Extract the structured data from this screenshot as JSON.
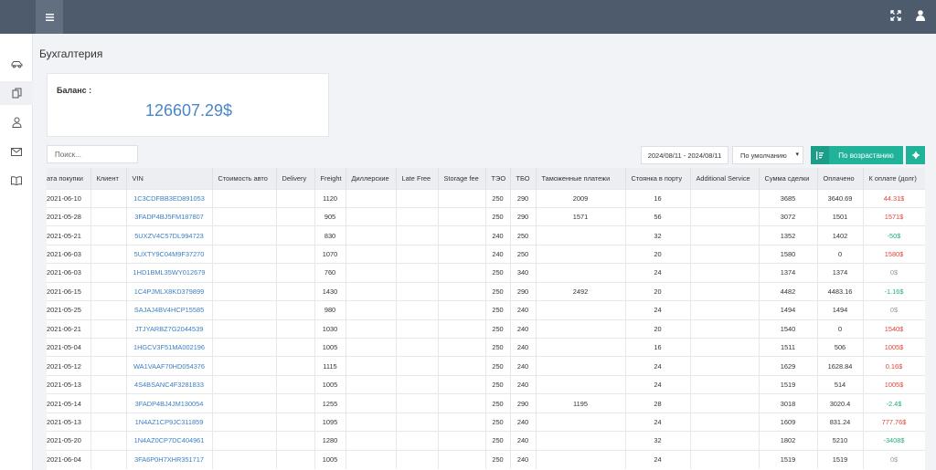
{
  "page_title": "Бухгалтерия",
  "balance": {
    "label": "Баланс :",
    "value": "126607.29$"
  },
  "search": {
    "placeholder": "Поиск..."
  },
  "filters": {
    "date_range": "2024/08/11 - 2024/08/11",
    "sort_select": "По умолчанию",
    "sort_button": "По возрастанию"
  },
  "colors": {
    "topbar": "#4e5b6d",
    "accent": "#21b39a",
    "link": "#3c7ec4",
    "debt": "#e0443c",
    "overpaid": "#28a982"
  },
  "icons": {
    "topbar": [
      "hamburger-icon",
      "fullscreen-icon",
      "user-icon"
    ],
    "sidebar": [
      "car-icon",
      "documents-icon",
      "person-icon",
      "mail-icon",
      "book-icon"
    ],
    "buttons": [
      "sort-ascending-icon",
      "gear-icon"
    ]
  },
  "table": {
    "headers": [
      "ата покупки",
      "Клиент",
      "VIN",
      "Стоимость авто",
      "Delivery",
      "Freight",
      "Диллерские",
      "Late Free",
      "Storage fee",
      "ТЭО",
      "ТБО",
      "Таможенные платежи",
      "Стоянка в порту",
      "Additional Service",
      "Сумма сделки",
      "Оплачено",
      "К оплате (долг)"
    ],
    "rows": [
      {
        "date": "2021-06-10",
        "vin": "1C3CDFBB3ED891053",
        "freight": "1120",
        "teo": "250",
        "tbo": "290",
        "customs": "2009",
        "parking": "16",
        "total": "3685",
        "paid": "3640.69",
        "debt": "44.31$",
        "status": "red"
      },
      {
        "date": "2021-05-28",
        "vin": "3FADP4BJ5FM187807",
        "freight": "905",
        "teo": "250",
        "tbo": "290",
        "customs": "1571",
        "parking": "56",
        "total": "3072",
        "paid": "1501",
        "debt": "1571$",
        "status": "red"
      },
      {
        "date": "2021-05-21",
        "vin": "5UXZV4C57DL994723",
        "freight": "830",
        "teo": "240",
        "tbo": "250",
        "customs": "",
        "parking": "32",
        "total": "1352",
        "paid": "1402",
        "debt": "-50$",
        "status": "green"
      },
      {
        "date": "2021-06-03",
        "vin": "5UXTY9C04M9F37270",
        "freight": "1070",
        "teo": "240",
        "tbo": "250",
        "customs": "",
        "parking": "20",
        "total": "1580",
        "paid": "0",
        "debt": "1580$",
        "status": "red"
      },
      {
        "date": "2021-06-03",
        "vin": "1HD1BML35WY012679",
        "freight": "760",
        "teo": "250",
        "tbo": "340",
        "customs": "",
        "parking": "24",
        "total": "1374",
        "paid": "1374",
        "debt": "0$",
        "status": "grey"
      },
      {
        "date": "2021-06-15",
        "vin": "1C4PJMLX8KD379899",
        "freight": "1430",
        "teo": "250",
        "tbo": "290",
        "customs": "2492",
        "parking": "20",
        "total": "4482",
        "paid": "4483.16",
        "debt": "-1.16$",
        "status": "green"
      },
      {
        "date": "2021-05-25",
        "vin": "SAJAJ4BV4HCP15585",
        "freight": "980",
        "teo": "250",
        "tbo": "240",
        "customs": "",
        "parking": "24",
        "total": "1494",
        "paid": "1494",
        "debt": "0$",
        "status": "grey"
      },
      {
        "date": "2021-06-21",
        "vin": "JTJYARBZ7G2044539",
        "freight": "1030",
        "teo": "250",
        "tbo": "240",
        "customs": "",
        "parking": "20",
        "total": "1540",
        "paid": "0",
        "debt": "1540$",
        "status": "red"
      },
      {
        "date": "2021-05-04",
        "vin": "1HGCV3F51MA002196",
        "freight": "1005",
        "teo": "250",
        "tbo": "240",
        "customs": "",
        "parking": "16",
        "total": "1511",
        "paid": "506",
        "debt": "1005$",
        "status": "red"
      },
      {
        "date": "2021-05-12",
        "vin": "WA1VAAF70HD054376",
        "freight": "1115",
        "teo": "250",
        "tbo": "240",
        "customs": "",
        "parking": "24",
        "total": "1629",
        "paid": "1628.84",
        "debt": "0.16$",
        "status": "red"
      },
      {
        "date": "2021-05-13",
        "vin": "4S4BSANC4F3281833",
        "freight": "1005",
        "teo": "250",
        "tbo": "240",
        "customs": "",
        "parking": "24",
        "total": "1519",
        "paid": "514",
        "debt": "1005$",
        "status": "red"
      },
      {
        "date": "2021-05-14",
        "vin": "3FADP4BJ4JM130054",
        "freight": "1255",
        "teo": "250",
        "tbo": "290",
        "customs": "1195",
        "parking": "28",
        "total": "3018",
        "paid": "3020.4",
        "debt": "-2.4$",
        "status": "green"
      },
      {
        "date": "2021-05-13",
        "vin": "1N4AZ1CP9JC311859",
        "freight": "1095",
        "teo": "250",
        "tbo": "240",
        "customs": "",
        "parking": "24",
        "total": "1609",
        "paid": "831.24",
        "debt": "777.76$",
        "status": "red"
      },
      {
        "date": "2021-05-20",
        "vin": "1N4AZ0CP7DC404961",
        "freight": "1280",
        "teo": "250",
        "tbo": "240",
        "customs": "",
        "parking": "32",
        "total": "1802",
        "paid": "5210",
        "debt": "-3408$",
        "status": "green"
      },
      {
        "date": "2021-06-04",
        "vin": "3FA6P0H7XHR351717",
        "freight": "1005",
        "teo": "250",
        "tbo": "240",
        "customs": "",
        "parking": "24",
        "total": "1519",
        "paid": "1519",
        "debt": "0$",
        "status": "grey"
      }
    ]
  }
}
